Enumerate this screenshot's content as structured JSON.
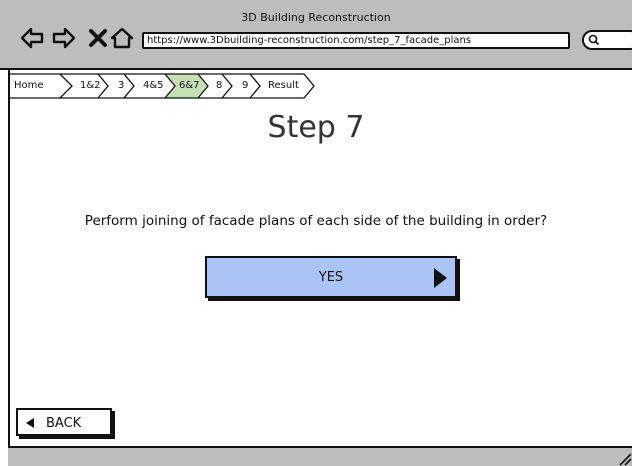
{
  "window": {
    "title": "3D Building Reconstruction",
    "url": "https://www.3Dbuilding-reconstruction.com/step_7_facade_plans"
  },
  "breadcrumb": {
    "items": [
      {
        "label": "Home",
        "active": false
      },
      {
        "label": "1&2",
        "active": false
      },
      {
        "label": "3",
        "active": false
      },
      {
        "label": "4&5",
        "active": false
      },
      {
        "label": "6&7",
        "active": true
      },
      {
        "label": "8",
        "active": false
      },
      {
        "label": "9",
        "active": false
      },
      {
        "label": "Result",
        "active": false
      }
    ],
    "active_color": "#c6e0b4"
  },
  "main": {
    "title": "Step 7",
    "question": "Perform joining of facade plans of each side of the building in order?",
    "yes_label": "YES",
    "back_label": "BACK"
  },
  "colors": {
    "chrome": "#bdbdbd",
    "yes_button": "#a9c4f5"
  },
  "icons": [
    "back-arrow-icon",
    "forward-arrow-icon",
    "close-icon",
    "home-icon",
    "search-icon",
    "play-arrow-icon",
    "back-triangle-icon",
    "resize-grip-icon"
  ]
}
